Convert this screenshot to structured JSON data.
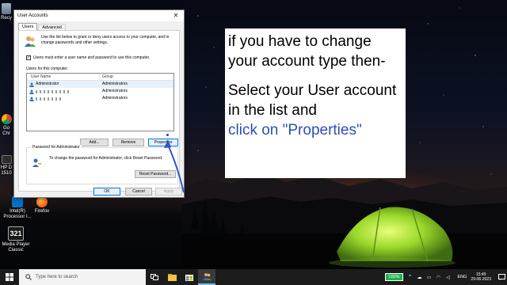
{
  "desktop": {
    "icons": [
      {
        "id": "recycle",
        "label": "Recy"
      },
      {
        "id": "chrome",
        "label": "Go Chr"
      },
      {
        "id": "hp",
        "label": "HP D 1510"
      },
      {
        "id": "intel",
        "label": "Intel(R) Processor I..."
      },
      {
        "id": "firefox",
        "label": "Firefox"
      },
      {
        "id": "mediaplayer",
        "label": "Media Player Classic"
      }
    ]
  },
  "dialog": {
    "title": "User Accounts",
    "close_glyph": "✕",
    "tabs": [
      "Users",
      "Advanced"
    ],
    "intro_text": "Use the list below to grant or deny users access to your computer, and to change passwords and other settings.",
    "checkbox_label": "Users must enter a user name and password to use this computer.",
    "checkbox_checked": true,
    "users_label": "Users for this computer:",
    "columns": [
      "User Name",
      "Group"
    ],
    "rows": [
      {
        "name": "Administrator",
        "group": "Administrators",
        "selected": true,
        "redacted": false
      },
      {
        "name": "",
        "group": "Administrators",
        "selected": false,
        "redacted": true
      },
      {
        "name": "",
        "group": "Administrators",
        "selected": false,
        "redacted": true
      }
    ],
    "buttons": {
      "add": "Add...",
      "remove": "Remove",
      "properties": "Properties"
    },
    "password_group": {
      "legend": "Password for Administrator",
      "text": "To change the password for Administrator, click Reset Password.",
      "reset": "Reset Password..."
    },
    "footer": {
      "ok": "OK",
      "cancel": "Cancel",
      "apply": "Apply"
    }
  },
  "note": {
    "line1": "if you have to change",
    "line2": "your account type then-",
    "line3": "Select your User account",
    "line4": "in the list and",
    "line5": "click on \"Properties\"",
    "accent_color": "#2b4fb8"
  },
  "taskbar": {
    "search_placeholder": "Type here to search",
    "battery": "100%",
    "language": "ENG",
    "time": "15:49",
    "date": "29-06-2023"
  }
}
